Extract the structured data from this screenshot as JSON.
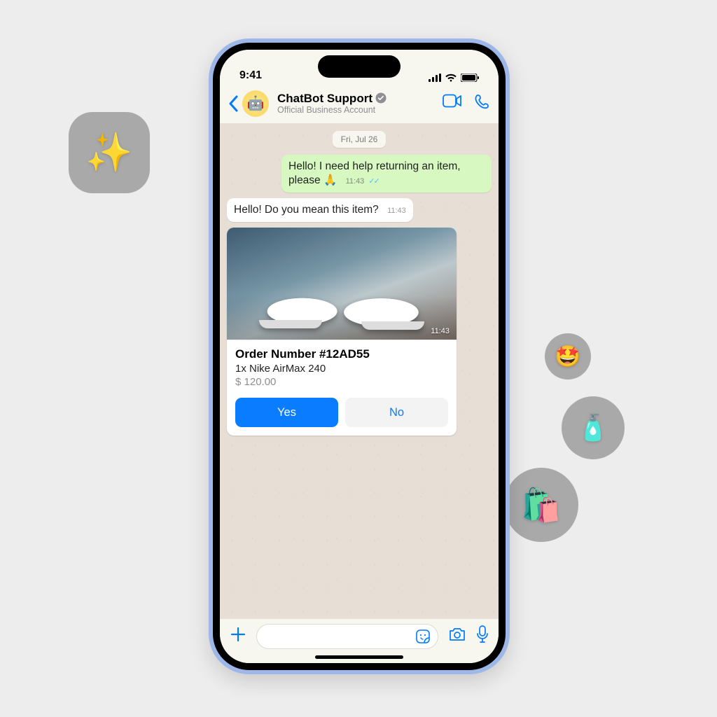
{
  "status": {
    "time": "9:41"
  },
  "header": {
    "title": "ChatBot Support",
    "subtitle": "Official Business Account",
    "avatar_emoji": "🤖"
  },
  "chat": {
    "date_label": "Fri, Jul 26",
    "outgoing": {
      "text": "Hello! I need help returning an item, please 🙏",
      "time": "11:43"
    },
    "incoming": {
      "text": "Hello! Do you mean this item?",
      "time": "11:43"
    },
    "product": {
      "image_time": "11:43",
      "order_title": "Order Number #12AD55",
      "order_line": "1x Nike AirMax 240",
      "price": "$ 120.00",
      "yes_label": "Yes",
      "no_label": "No"
    }
  },
  "deco": {
    "sparkle": "✨",
    "face": "🤩",
    "bottle": "🧴",
    "bags": "🛍️"
  }
}
